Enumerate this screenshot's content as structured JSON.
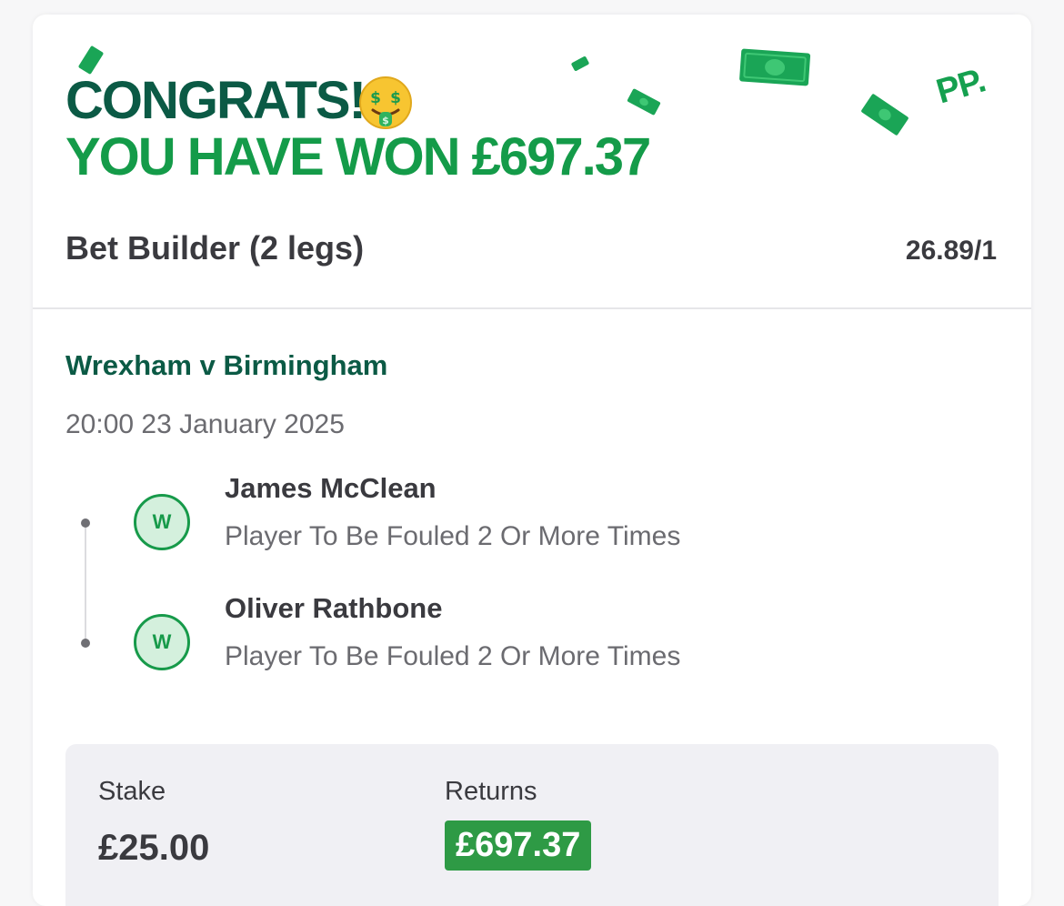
{
  "header": {
    "congrats": "CONGRATS!",
    "won_prefix": "YOU HAVE WON £697.37",
    "brand_logo": "PP.",
    "emoji_icon": "money-mouth-face-icon",
    "confetti_icon": "banknote-icon"
  },
  "bet": {
    "type": "Bet Builder (2 legs)",
    "odds": "26.89/1"
  },
  "match": {
    "title": "Wrexham v Birmingham",
    "datetime": "20:00 23 January 2025"
  },
  "legs": [
    {
      "result": "W",
      "player": "James McClean",
      "market": "Player To Be Fouled 2 Or More Times"
    },
    {
      "result": "W",
      "player": "Oliver Rathbone",
      "market": "Player To Be Fouled 2 Or More Times"
    }
  ],
  "summary": {
    "stake_label": "Stake",
    "stake_value": "£25.00",
    "returns_label": "Returns",
    "returns_value": "£697.37"
  },
  "colors": {
    "dark_green": "#0b5a45",
    "bright_green": "#149b49",
    "returns_bg": "#2e9a45",
    "text": "#3a3a3f",
    "muted": "#6b6b70"
  }
}
